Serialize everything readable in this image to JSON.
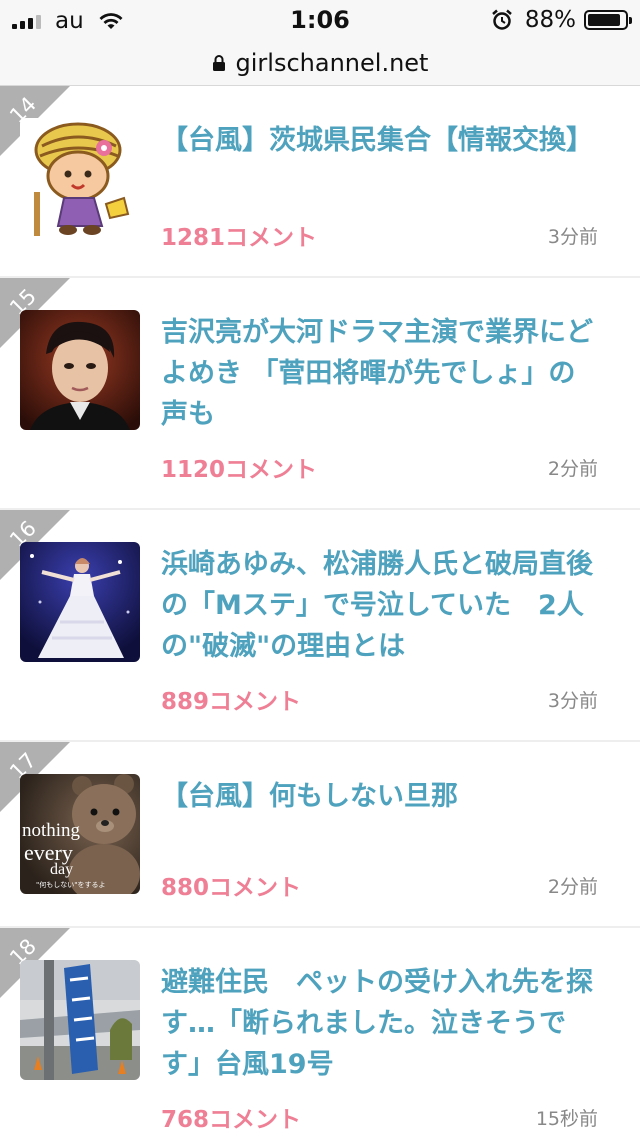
{
  "status_bar": {
    "carrier": "au",
    "time": "1:06",
    "battery_percent": "88%",
    "battery_level": 0.88
  },
  "browser": {
    "url": "girlschannel.net"
  },
  "topics": [
    {
      "rank": "14",
      "thumbnail": "mascot-character-image",
      "title": "【台風】茨城県民集合【情報交換】",
      "comments": "1281コメント",
      "time_ago": "3分前"
    },
    {
      "rank": "15",
      "thumbnail": "actor-photo",
      "title": "吉沢亮が大河ドラマ主演で業界にどよめき 「菅田将暉が先でしょ」の声も",
      "comments": "1120コメント",
      "time_ago": "2分前"
    },
    {
      "rank": "16",
      "thumbnail": "stage-singer-photo",
      "title": "浜崎あゆみ、松浦勝人氏と破局直後の「Mステ」で号泣していた　2人の\"破滅\"の理由とは",
      "comments": "889コメント",
      "time_ago": "3分前"
    },
    {
      "rank": "17",
      "thumbnail": "teddy-bear-movie-image",
      "title": "【台風】何もしない旦那",
      "comments": "880コメント",
      "time_ago": "2分前",
      "thumb_text": {
        "line1": "nothing",
        "line2": "every",
        "line3": "day",
        "caption": "\"何もしない\"をするよ"
      }
    },
    {
      "rank": "18",
      "thumbnail": "shelter-sign-photo",
      "title": "避難住民　ペットの受け入れ先を探す…「断られました。泣きそうです」台風19号",
      "comments": "768コメント",
      "time_ago": "15秒前"
    }
  ],
  "colors": {
    "title": "#4ea2bd",
    "comments": "#ef7f95",
    "time_ago": "#888888",
    "rank_badge": "#b0b0b0"
  }
}
